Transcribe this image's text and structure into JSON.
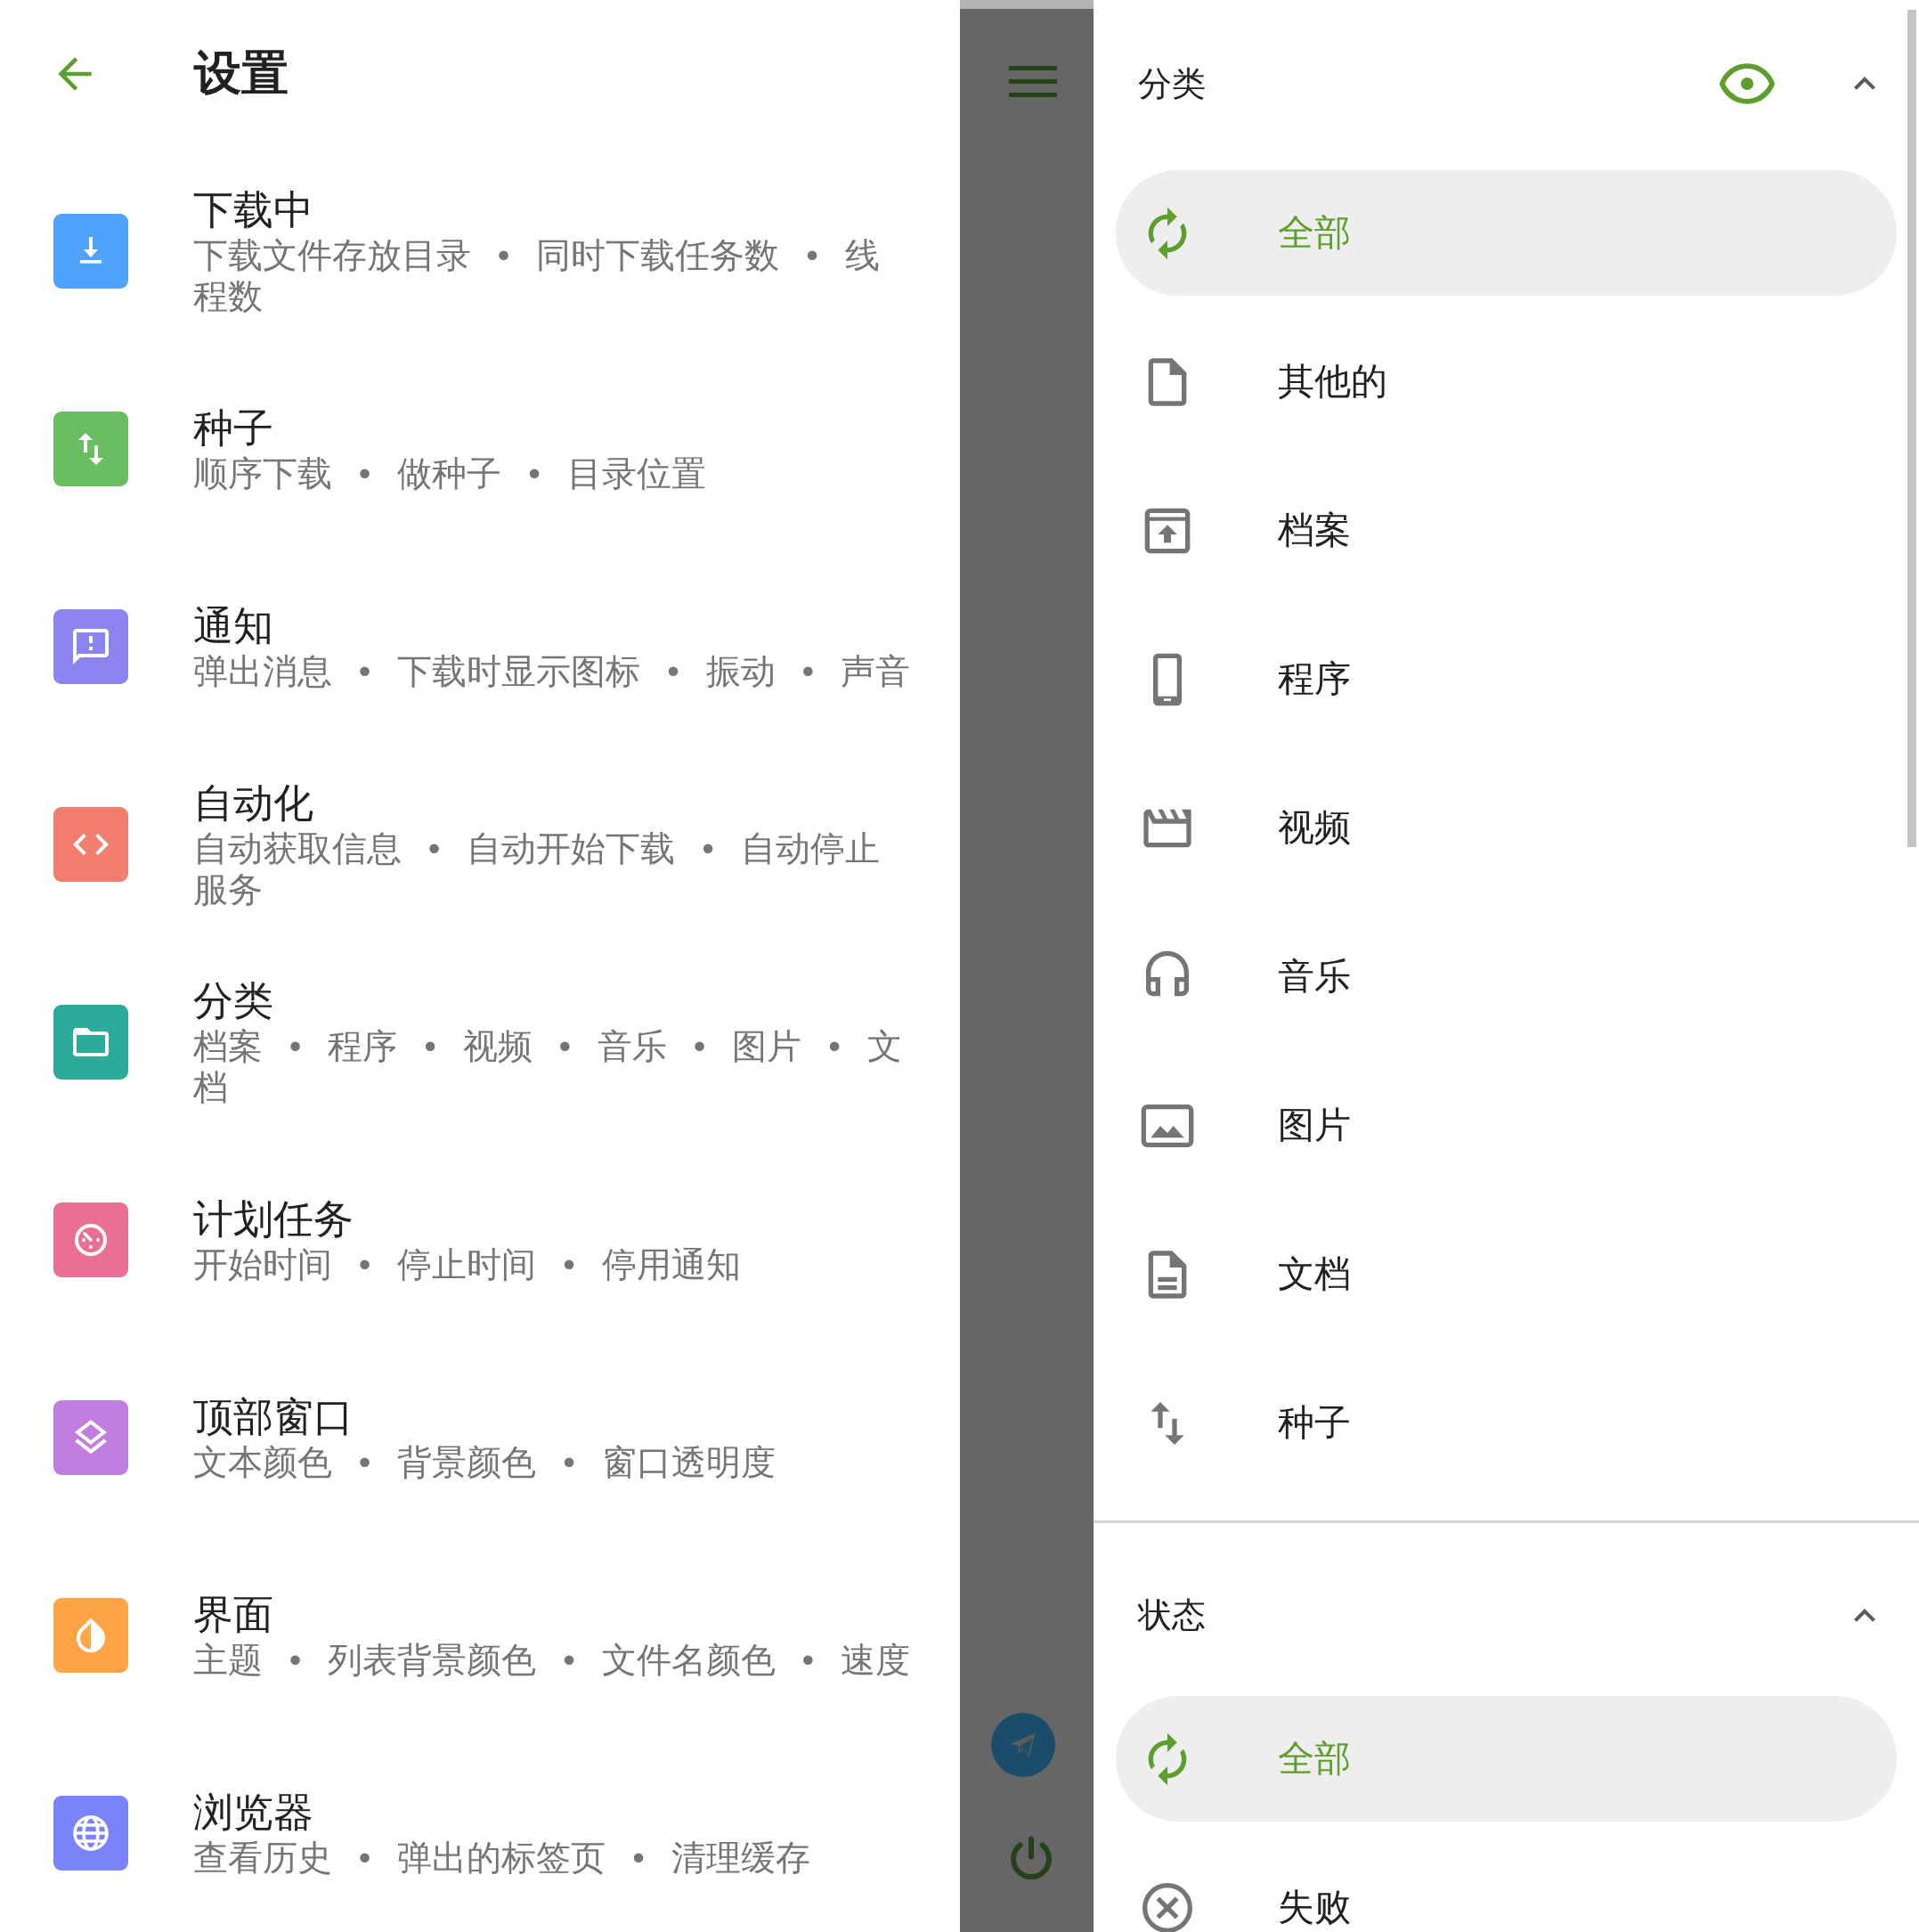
{
  "settings": {
    "title": "设置",
    "items": [
      {
        "title": "下载中",
        "subtitle": "下载文件存放目录 • 同时下载任务数 • 线程数",
        "color": "#4fa3fb"
      },
      {
        "title": "种子",
        "subtitle": "顺序下载 • 做种子 • 目录位置",
        "color": "#6abe62"
      },
      {
        "title": "通知",
        "subtitle": "弹出消息 • 下载时显示图标 • 振动 • 声音",
        "color": "#8c84f0"
      },
      {
        "title": "自动化",
        "subtitle": "自动获取信息 • 自动开始下载 • 自动停止服务",
        "color": "#f27e70"
      },
      {
        "title": "分类",
        "subtitle": "档案 • 程序 • 视频 • 音乐 • 图片 • 文档",
        "color": "#2bab98"
      },
      {
        "title": "计划任务",
        "subtitle": "开始时间 • 停止时间 • 停用通知",
        "color": "#e96f93"
      },
      {
        "title": "顶部窗口",
        "subtitle": "文本颜色 • 背景颜色 • 窗口透明度",
        "color": "#c27de0"
      },
      {
        "title": "界面",
        "subtitle": "主题 • 列表背景颜色 • 文件名颜色 • 速度",
        "color": "#fea646"
      },
      {
        "title": "浏览器",
        "subtitle": "查看历史 • 弹出的标签页 • 清理缓存",
        "color": "#7b83fa"
      }
    ]
  },
  "filters": {
    "sections": [
      {
        "title": "分类",
        "expanded": true,
        "visibility_toggle": true,
        "items": [
          {
            "label": "全部",
            "selected": true
          },
          {
            "label": "其他的",
            "selected": false
          },
          {
            "label": "档案",
            "selected": false
          },
          {
            "label": "程序",
            "selected": false
          },
          {
            "label": "视频",
            "selected": false
          },
          {
            "label": "音乐",
            "selected": false
          },
          {
            "label": "图片",
            "selected": false
          },
          {
            "label": "文档",
            "selected": false
          },
          {
            "label": "种子",
            "selected": false
          }
        ]
      },
      {
        "title": "状态",
        "expanded": true,
        "visibility_toggle": false,
        "items": [
          {
            "label": "全部",
            "selected": true
          },
          {
            "label": "失败",
            "selected": false
          }
        ]
      }
    ]
  }
}
